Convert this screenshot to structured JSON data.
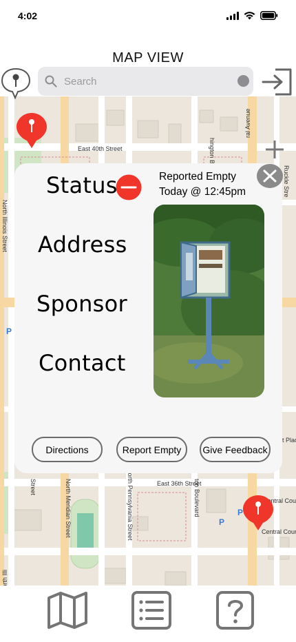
{
  "status_bar": {
    "time": "4:02",
    "icons": [
      "signal-icon",
      "wifi-icon",
      "battery-icon"
    ]
  },
  "header": {
    "title": "MAP VIEW"
  },
  "search": {
    "placeholder": "Search",
    "value": ""
  },
  "map": {
    "street_labels": [
      "East 40th Street",
      "hington Boulevard",
      "ral Avenue",
      "North Illinois Street",
      "Ruckle Stre",
      "East 36th Street",
      "North Meridian Street",
      "North Pennsylvania Street",
      "ton Boulevard",
      "Central Court S",
      "Central Court S",
      "Street",
      "North Illi",
      "t Plac"
    ],
    "markers": [
      "library-pin-north",
      "library-pin-south"
    ]
  },
  "detail_card": {
    "status_label": "Status",
    "address_label": "Address",
    "sponsor_label": "Sponsor",
    "contact_label": "Contact",
    "report_status": "Reported Empty",
    "report_time": "Today @ 12:45pm",
    "directions_label": "Directions",
    "report_empty_label": "Report Empty",
    "feedback_label": "Give Feedback",
    "status_color": "#f0352a"
  },
  "tab_bar": {
    "tabs": [
      "map-icon",
      "list-icon",
      "help-icon"
    ]
  },
  "colors": {
    "pin": "#f0352a",
    "card_background": "#f6f6f6",
    "map_background": "#ece6dc",
    "road": "#ffffff",
    "major_road": "#f7d7a2",
    "park": "#cfe5c3",
    "icon_gray": "#757575"
  }
}
